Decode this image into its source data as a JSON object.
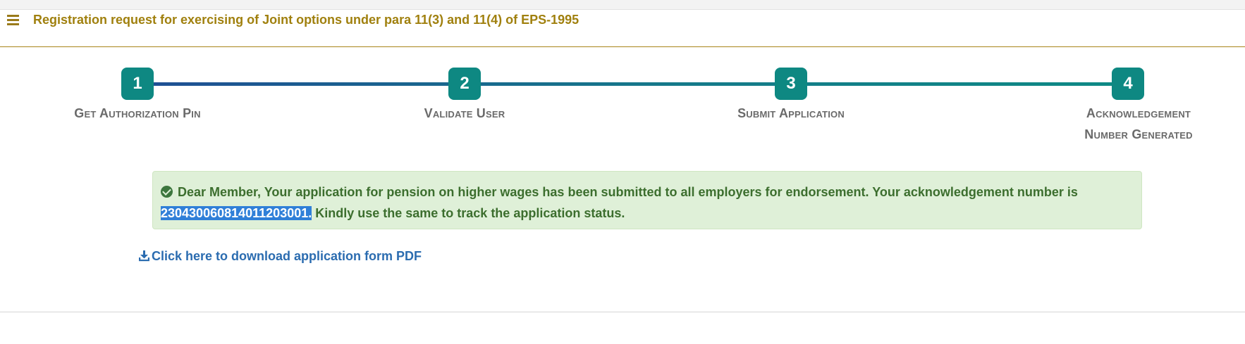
{
  "header": {
    "title": "Registration request for exercising of Joint options under para 11(3) and 11(4) of EPS-1995",
    "menu_icon": "hamburger-icon"
  },
  "steps": [
    {
      "number": "1",
      "label": "Get Authorization Pin"
    },
    {
      "number": "2",
      "label": "Validate User"
    },
    {
      "number": "3",
      "label": "Submit Application"
    },
    {
      "number": "4",
      "label": "Acknowledgement Number Generated"
    }
  ],
  "alert": {
    "text_before": "Dear Member, Your application for pension on higher wages has been submitted to all employers for endorsement. Your acknowledgement number is ",
    "ack_number": "230430060814011203001.",
    "text_after": " Kindly use the same to track the application status.",
    "icon": "check-circle-icon"
  },
  "download": {
    "label": "Click here to download application form PDF",
    "icon": "download-icon"
  },
  "colors": {
    "accent_gold": "#a0800e",
    "step_teal": "#0e8882",
    "alert_bg": "#dff0d8",
    "link_blue": "#2b6cb0"
  }
}
